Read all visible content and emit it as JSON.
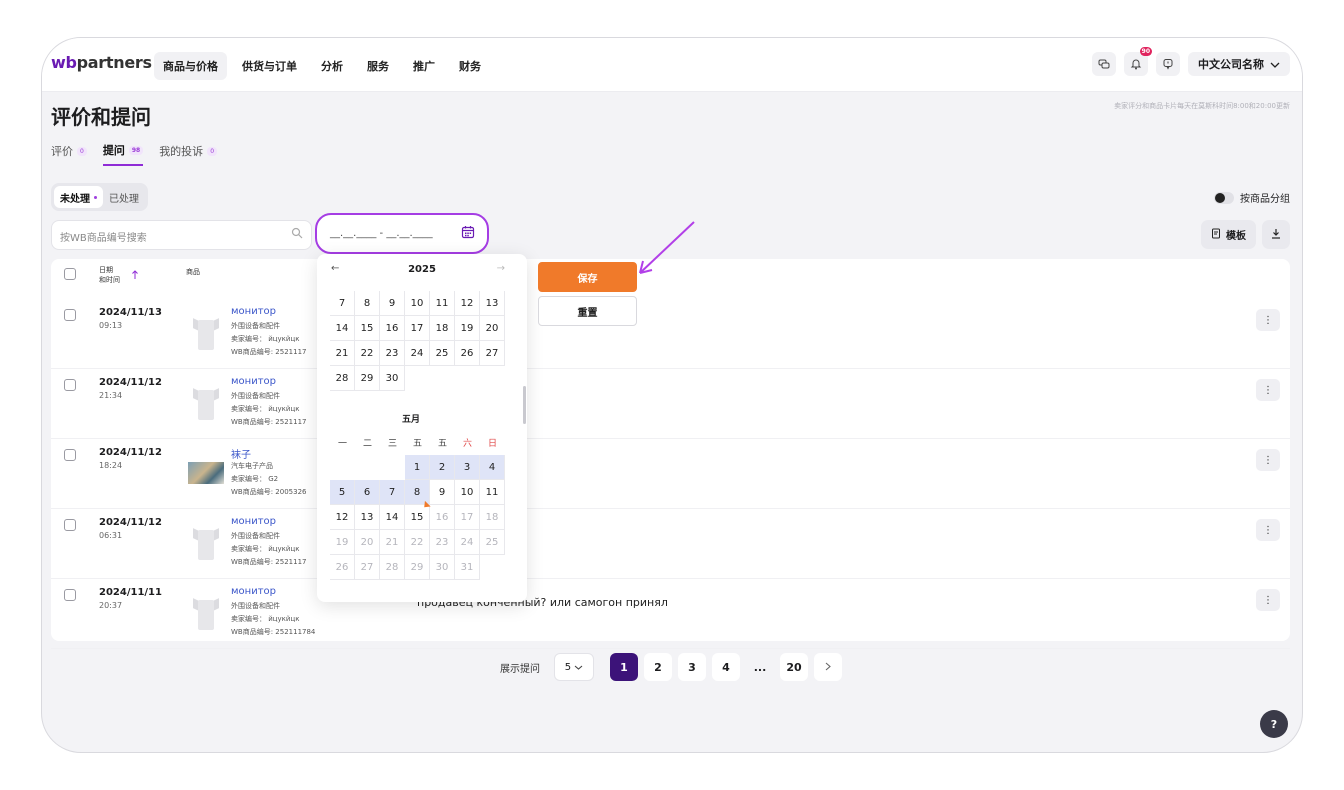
{
  "app": {
    "logo_prefix": "wb",
    "logo_suffix": "partners"
  },
  "nav": {
    "items": [
      "商品与价格",
      "供货与订单",
      "分析",
      "服务",
      "推广",
      "财务"
    ]
  },
  "topbar": {
    "notification_count": "90",
    "company": "中文公司名称"
  },
  "page": {
    "title": "评价和提问",
    "notice": "卖家评分和商品卡片每天在莫斯科时间8:00和20:00更新"
  },
  "tabs": [
    {
      "label": "评价",
      "count": "0"
    },
    {
      "label": "提问",
      "count": "98"
    },
    {
      "label": "我的投诉",
      "count": "0"
    }
  ],
  "status_filter": {
    "unprocessed": "未处理",
    "processed": "已处理"
  },
  "group_toggle": {
    "label": "按商品分组"
  },
  "search": {
    "placeholder": "按WB商品编号搜索"
  },
  "date_range": {
    "value": "__.__.____ - __.__.____"
  },
  "toolbar": {
    "template_label": "模板"
  },
  "table": {
    "headers": {
      "date": "日期",
      "time": "和时间",
      "product": "商品"
    },
    "rows": [
      {
        "date": "2024/11/13",
        "time": "09:13",
        "name": "монитор",
        "category": "外围设备和配件",
        "sku": "卖家编号：  йцукйцк",
        "wb": "WB商品编号: 2521117",
        "image": "tshirt",
        "text": ""
      },
      {
        "date": "2024/11/12",
        "time": "21:34",
        "name": "монитор",
        "category": "外围设备和配件",
        "sku": "卖家编号：  йцукйцк",
        "wb": "WB商品编号: 2521117",
        "image": "tshirt",
        "text": ""
      },
      {
        "date": "2024/11/12",
        "time": "18:24",
        "name": "袜子",
        "category": "汽车电子产品",
        "sku": "卖家编号：  G2",
        "wb": "WB商品编号: 2005326",
        "image": "photo",
        "text": ""
      },
      {
        "date": "2024/11/12",
        "time": "06:31",
        "name": "монитор",
        "category": "外围设备和配件",
        "sku": "卖家编号：  йцукйцк",
        "wb": "WB商品编号: 2521117",
        "image": "tshirt",
        "text": ""
      },
      {
        "date": "2024/11/11",
        "time": "20:37",
        "name": "монитор",
        "category": "外围设备和配件",
        "sku": "卖家编号：  йцукйцк",
        "wb": "WB商品编号: 252111784",
        "image": "tshirt",
        "text": "продавец конченный? или самогон принял"
      }
    ]
  },
  "calendar": {
    "year": "2025",
    "prev_month_days": [
      [
        "7",
        "8",
        "9",
        "10",
        "11",
        "12",
        "13"
      ],
      [
        "14",
        "15",
        "16",
        "17",
        "18",
        "19",
        "20"
      ],
      [
        "21",
        "22",
        "23",
        "24",
        "25",
        "26",
        "27"
      ],
      [
        "28",
        "29",
        "30"
      ]
    ],
    "month_label": "五月",
    "weekdays": [
      "一",
      "二",
      "三",
      "五",
      "五",
      "六",
      "日"
    ],
    "month_days": [
      [
        "",
        "",
        "",
        "1",
        "2",
        "3",
        "4"
      ],
      [
        "5",
        "6",
        "7",
        "8",
        "9",
        "10",
        "11"
      ],
      [
        "12",
        "13",
        "14",
        "15",
        "16",
        "17",
        "18"
      ],
      [
        "19",
        "20",
        "21",
        "22",
        "23",
        "24",
        "25"
      ],
      [
        "26",
        "27",
        "28",
        "29",
        "30",
        "31"
      ]
    ],
    "selected": [
      "1",
      "2",
      "3",
      "4",
      "5",
      "6",
      "7",
      "8"
    ],
    "today": "8",
    "last_active": 15,
    "save_label": "保存",
    "reset_label": "重置"
  },
  "pagination": {
    "label": "展示提问",
    "page_size": "5",
    "pages": [
      "1",
      "2",
      "3",
      "4",
      "...",
      "20"
    ],
    "current": "1"
  },
  "help": {
    "label": "?"
  },
  "colors": {
    "accent": "#f07a2a",
    "brand": "#6a1bb3",
    "highlight": "#a53de4",
    "active_page": "#3c1379"
  }
}
